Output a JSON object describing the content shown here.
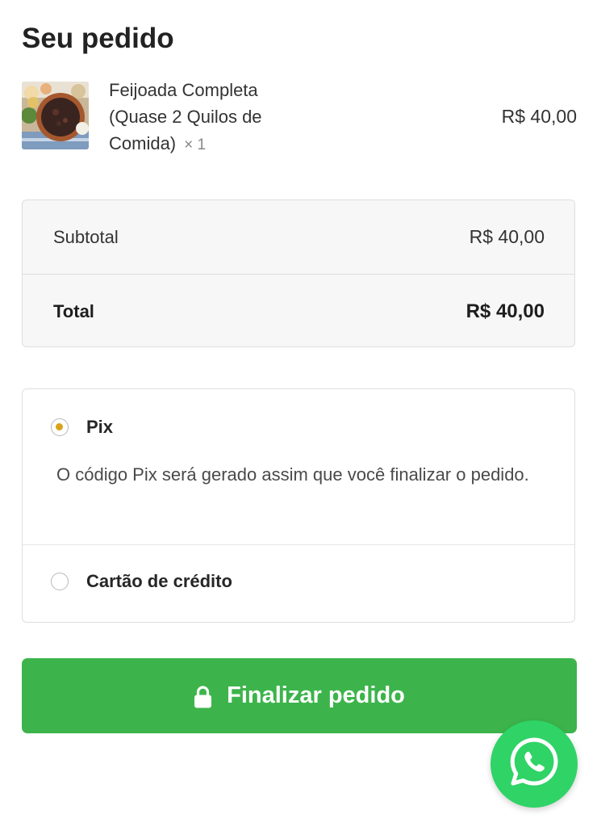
{
  "page": {
    "title": "Seu pedido"
  },
  "order_item": {
    "name": "Feijoada Completa (Quase 2 Quilos de Comida)",
    "quantity": "× 1",
    "price": "R$ 40,00"
  },
  "totals": {
    "subtotal_label": "Subtotal",
    "subtotal_value": "R$ 40,00",
    "total_label": "Total",
    "total_value": "R$ 40,00"
  },
  "payment": {
    "options": [
      {
        "label": "Pix",
        "selected": true,
        "description": "O código Pix será gerado assim que você finalizar o pedido."
      },
      {
        "label": "Cartão de crédito",
        "selected": false
      }
    ]
  },
  "actions": {
    "finalize_label": "Finalizar pedido"
  },
  "icons": {
    "lock": "lock-icon",
    "whatsapp": "whatsapp-icon"
  },
  "colors": {
    "primary_button": "#3cb44b",
    "radio_selected": "#d9a21b",
    "whatsapp": "#2fd366"
  }
}
